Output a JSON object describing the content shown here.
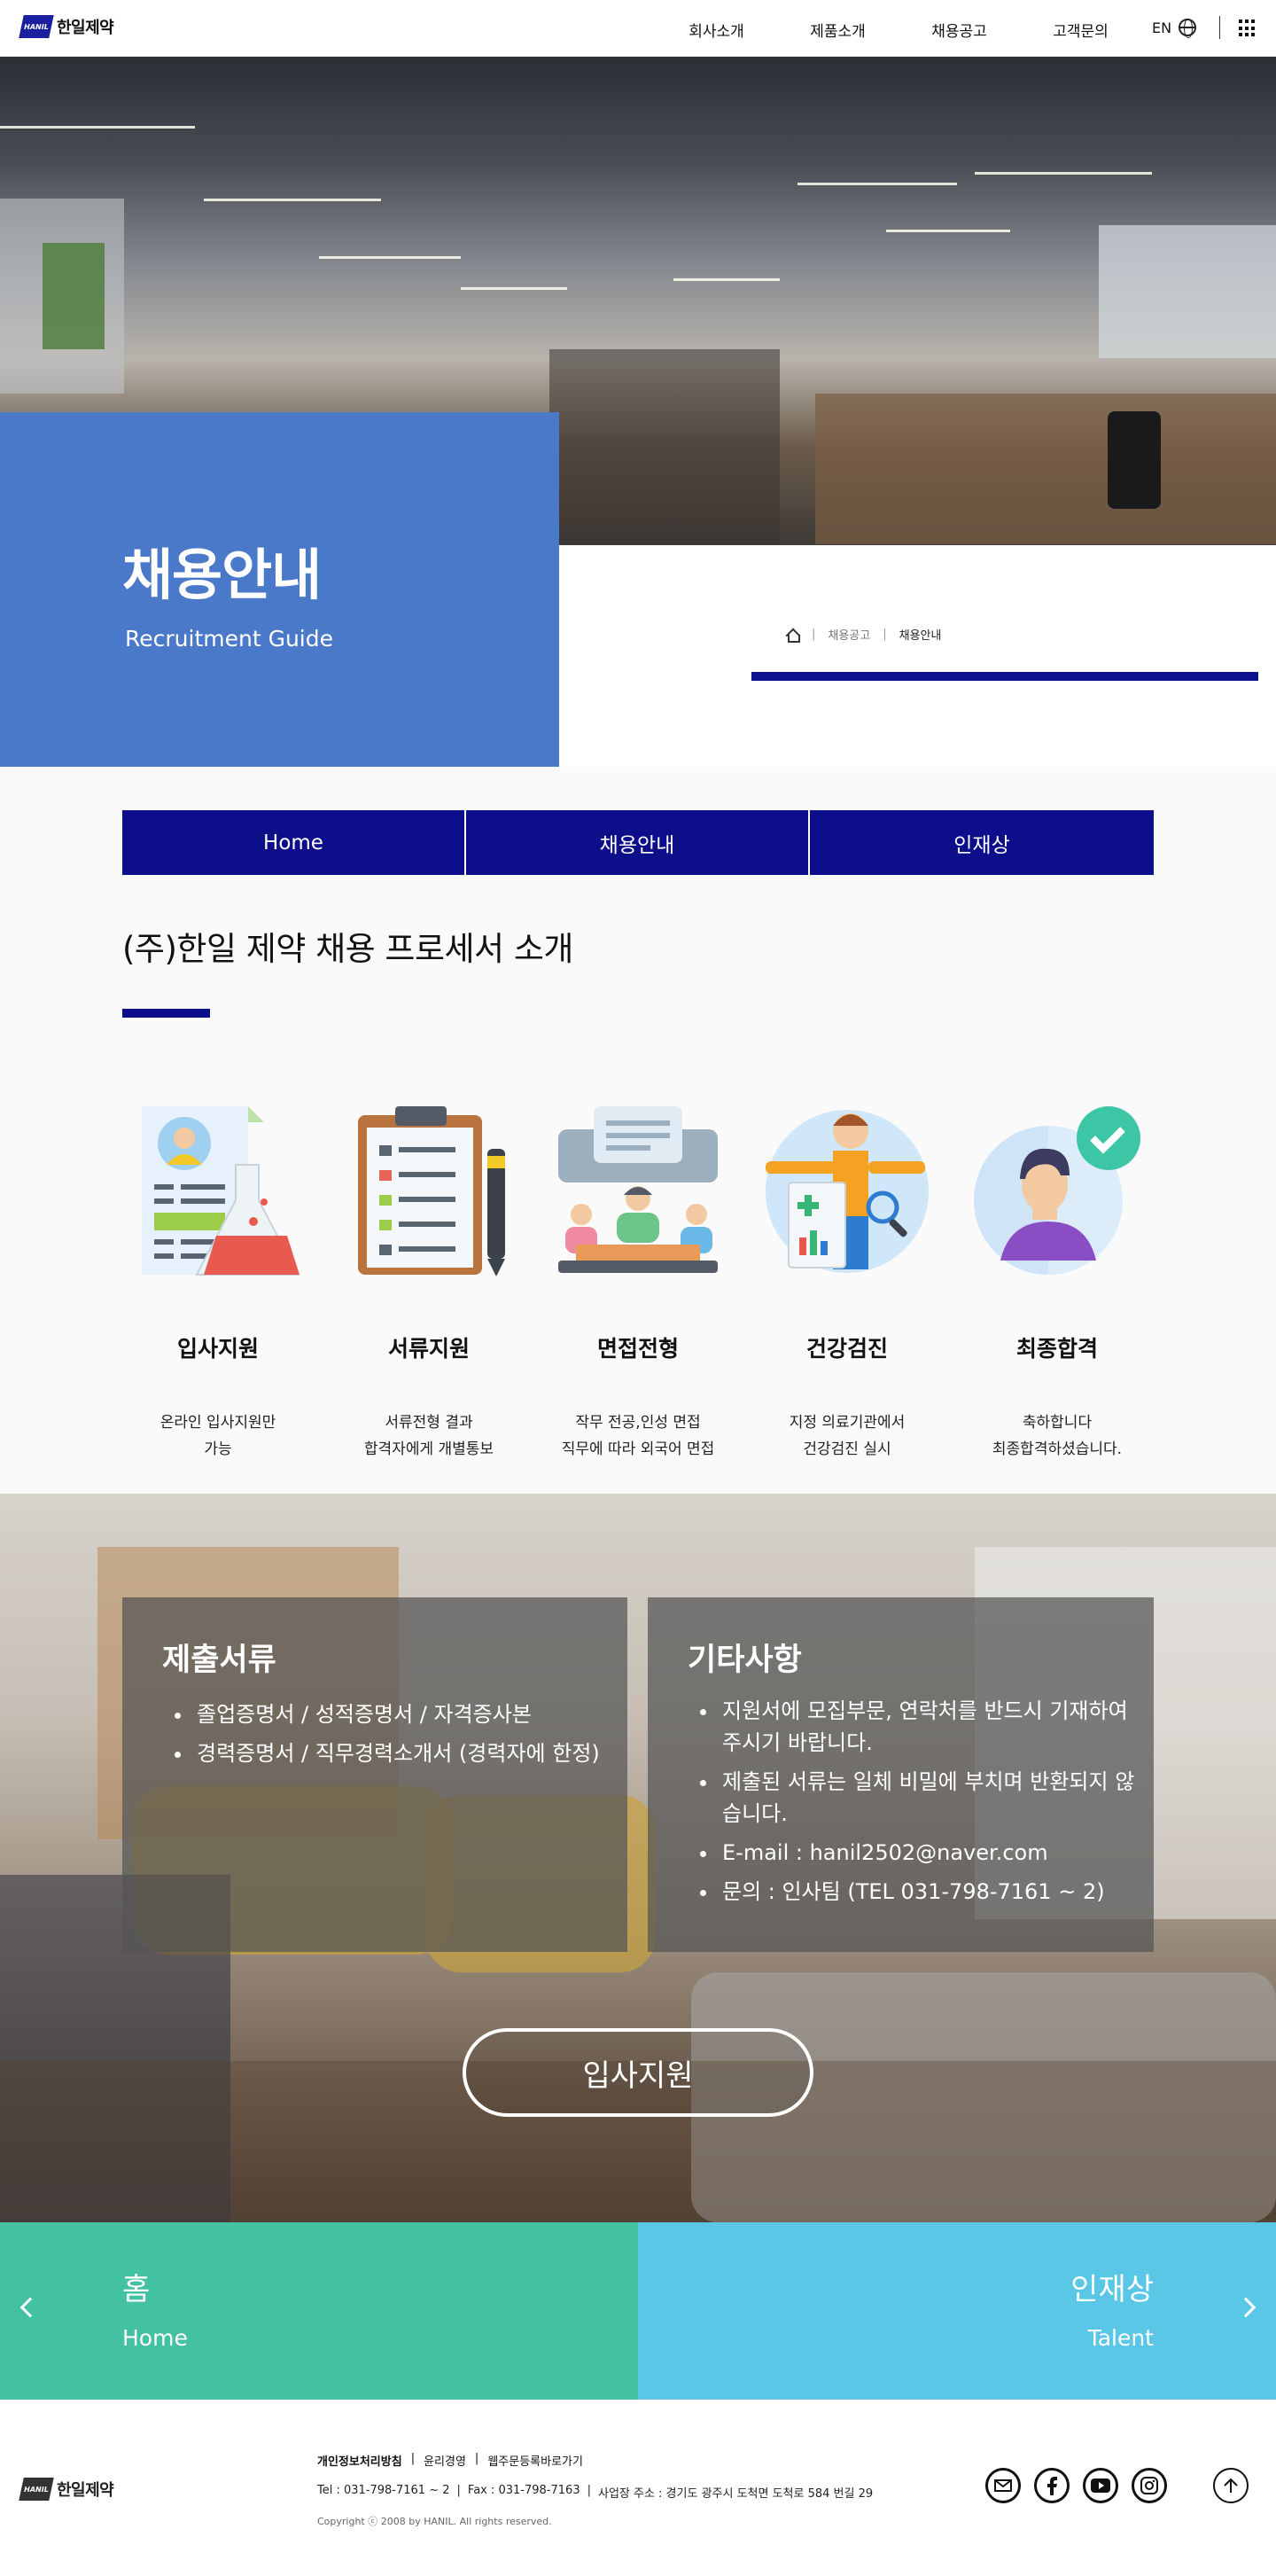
{
  "header": {
    "logo_mark": "HANIL",
    "logo_text": "한일제약",
    "nav": [
      "회사소개",
      "제품소개",
      "채용공고",
      "고객문의"
    ],
    "lang": "EN"
  },
  "hero": {
    "title": "채용안내",
    "subtitle": "Recruitment Guide",
    "breadcrumb": [
      "채용공고",
      "채용안내"
    ]
  },
  "tabs": [
    "Home",
    "채용안내",
    "인재상"
  ],
  "section_title": "(주)한일 제약 채용 프로세서 소개",
  "steps": [
    {
      "label": "입사지원",
      "desc1": "온라인 입사지원만",
      "desc2": "가능"
    },
    {
      "label": "서류지원",
      "desc1": "서류전형 결과",
      "desc2": "합격자에게 개별통보"
    },
    {
      "label": "면접전형",
      "desc1": "작무 전공,인성 면접",
      "desc2": "직무에 따라 외국어 면접"
    },
    {
      "label": "건강검진",
      "desc1": "지정 의료기관에서",
      "desc2": "건강검진 실시"
    },
    {
      "label": "최종합격",
      "desc1": "축하합니다",
      "desc2": "최종합격하셨습니다."
    }
  ],
  "documents": {
    "title": "제출서류",
    "items": [
      "졸업증명서 / 성적증명서 / 자격증사본",
      "경력증명서 / 직무경력소개서 (경력자에 한정)"
    ]
  },
  "etc": {
    "title": "기타사항",
    "items": [
      "지원서에 모집부문, 연락처를 반드시 기재하여 주시기 바랍니다.",
      "제출된 서류는 일체 비밀에 부치며 반환되지 않습니다.",
      "E-mail : hanil2502@naver.com",
      "문의 : 인사팀 (TEL 031-798-7161 ~ 2)"
    ]
  },
  "apply_button": "입사지원",
  "bottom_nav": {
    "prev_ko": "홈",
    "prev_en": "Home",
    "next_ko": "인재상",
    "next_en": "Talent"
  },
  "footer": {
    "logo_text": "한일제약",
    "links": [
      "개인정보처리방침",
      "윤리경영",
      "웹주문등록바로가기"
    ],
    "tel": "Tel : 031-798-7161 ~ 2",
    "fax": "Fax : 031-798-7163",
    "address": "사업장 주소 : 경기도 광주시 도척면 도척로 584 번길 29",
    "copyright": "Copyright ⓒ 2008 by HANIL. All rights reserved."
  },
  "colors": {
    "brand_navy": "#0c0e8a",
    "hero_blue": "#4a79c9",
    "teal": "#44c1a3",
    "sky": "#5ac7e6"
  },
  "icons": [
    "home-icon",
    "globe-icon",
    "grid-menu-icon",
    "mail-icon",
    "facebook-icon",
    "youtube-icon",
    "instagram-icon",
    "arrow-up-icon",
    "chevron-left-icon",
    "chevron-right-icon"
  ]
}
